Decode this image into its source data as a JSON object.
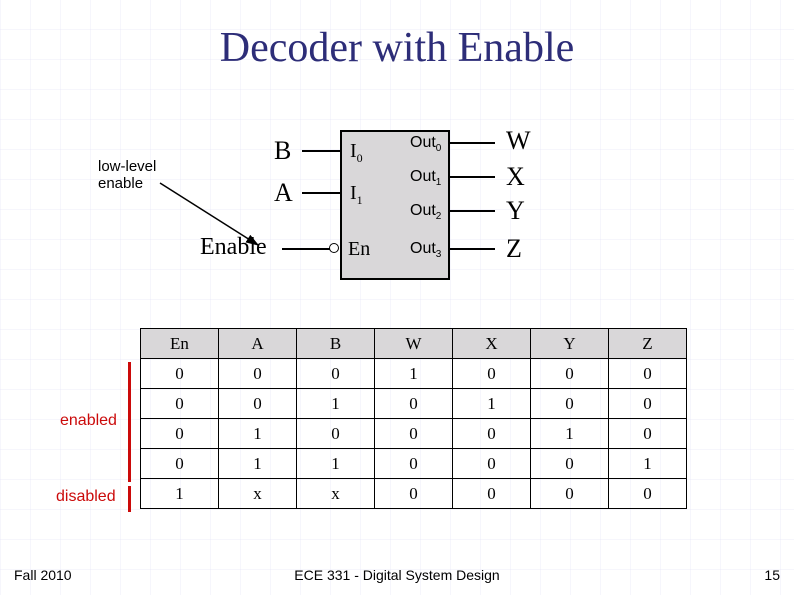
{
  "title": "Decoder with Enable",
  "note": {
    "l1": "low-level",
    "l2": "enable"
  },
  "inputs": {
    "b": "B",
    "a": "A",
    "en": "Enable"
  },
  "pins": {
    "i0": "I",
    "i0s": "0",
    "i1": "I",
    "i1s": "1",
    "en": "En"
  },
  "outs": {
    "o0": "Out",
    "o0s": "0",
    "o1": "Out",
    "o1s": "1",
    "o2": "Out",
    "o2s": "2",
    "o3": "Out",
    "o3s": "3"
  },
  "sigs": {
    "w": "W",
    "x": "X",
    "y": "Y",
    "z": "Z"
  },
  "table": {
    "headers": [
      "En",
      "A",
      "B",
      "W",
      "X",
      "Y",
      "Z"
    ],
    "rows": [
      [
        "0",
        "0",
        "0",
        "1",
        "0",
        "0",
        "0"
      ],
      [
        "0",
        "0",
        "1",
        "0",
        "1",
        "0",
        "0"
      ],
      [
        "0",
        "1",
        "0",
        "0",
        "0",
        "1",
        "0"
      ],
      [
        "0",
        "1",
        "1",
        "0",
        "0",
        "0",
        "1"
      ],
      [
        "1",
        "x",
        "x",
        "0",
        "0",
        "0",
        "0"
      ]
    ]
  },
  "labels": {
    "enabled": "enabled",
    "disabled": "disabled"
  },
  "footer": {
    "left": "Fall 2010",
    "center": "ECE 331 - Digital System Design",
    "right": "15"
  }
}
